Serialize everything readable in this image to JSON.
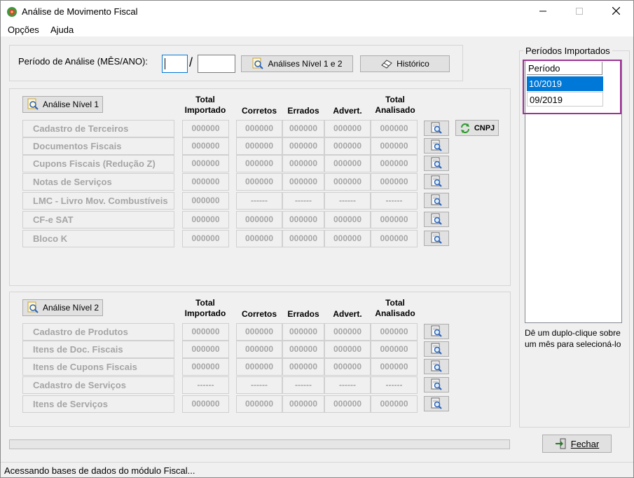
{
  "window": {
    "title": "Análise de Movimento Fiscal"
  },
  "menu": {
    "options": "Opções",
    "help": "Ajuda"
  },
  "period": {
    "label": "Período de Análise (MÊS/ANO):",
    "month": "",
    "year": "",
    "separator": "/",
    "analyses_button": "Análises Nível 1 e 2",
    "history_button": "Histórico"
  },
  "columns": {
    "total_importado": "Total\nImportado",
    "corretos": "Corretos",
    "errados": "Errados",
    "advert": "Advert.",
    "total_analisado": "Total\nAnalisado"
  },
  "level1": {
    "button": "Análise Nível 1",
    "cnpj_button": "CNPJ",
    "rows": [
      {
        "label": "Cadastro de Terceiros",
        "values": [
          "000000",
          "000000",
          "000000",
          "000000",
          "000000"
        ]
      },
      {
        "label": "Documentos Fiscais",
        "values": [
          "000000",
          "000000",
          "000000",
          "000000",
          "000000"
        ]
      },
      {
        "label": "Cupons Fiscais (Redução Z)",
        "values": [
          "000000",
          "000000",
          "000000",
          "000000",
          "000000"
        ]
      },
      {
        "label": "Notas de Serviços",
        "values": [
          "000000",
          "000000",
          "000000",
          "000000",
          "000000"
        ]
      },
      {
        "label": "LMC - Livro Mov. Combustíveis",
        "values": [
          "000000",
          "------",
          "------",
          "------",
          "------"
        ]
      },
      {
        "label": "CF-e SAT",
        "values": [
          "000000",
          "000000",
          "000000",
          "000000",
          "000000"
        ]
      },
      {
        "label": "Bloco K",
        "values": [
          "000000",
          "000000",
          "000000",
          "000000",
          "000000"
        ]
      }
    ]
  },
  "level2": {
    "button": "Análise Nível 2",
    "rows": [
      {
        "label": "Cadastro de Produtos",
        "values": [
          "000000",
          "000000",
          "000000",
          "000000",
          "000000"
        ]
      },
      {
        "label": "Itens de Doc. Fiscais",
        "values": [
          "000000",
          "000000",
          "000000",
          "000000",
          "000000"
        ]
      },
      {
        "label": "Itens de Cupons Fiscais",
        "values": [
          "000000",
          "000000",
          "000000",
          "000000",
          "000000"
        ]
      },
      {
        "label": "Cadastro de Serviços",
        "values": [
          "------",
          "------",
          "------",
          "------",
          "------"
        ]
      },
      {
        "label": "Itens de Serviços",
        "values": [
          "000000",
          "000000",
          "000000",
          "000000",
          "000000"
        ]
      }
    ]
  },
  "imported": {
    "title": "Períodos Importados",
    "header": "Período",
    "items": [
      "10/2019",
      "09/2019"
    ],
    "selected_index": 0,
    "hint": "Dê um duplo-clique sobre um mês para selecioná-lo"
  },
  "close_button": "Fechar",
  "status": "Acessando bases de dados do módulo Fiscal...",
  "progress": 0,
  "colors": {
    "selection": "#0078d7",
    "highlight": "#9b3595"
  }
}
